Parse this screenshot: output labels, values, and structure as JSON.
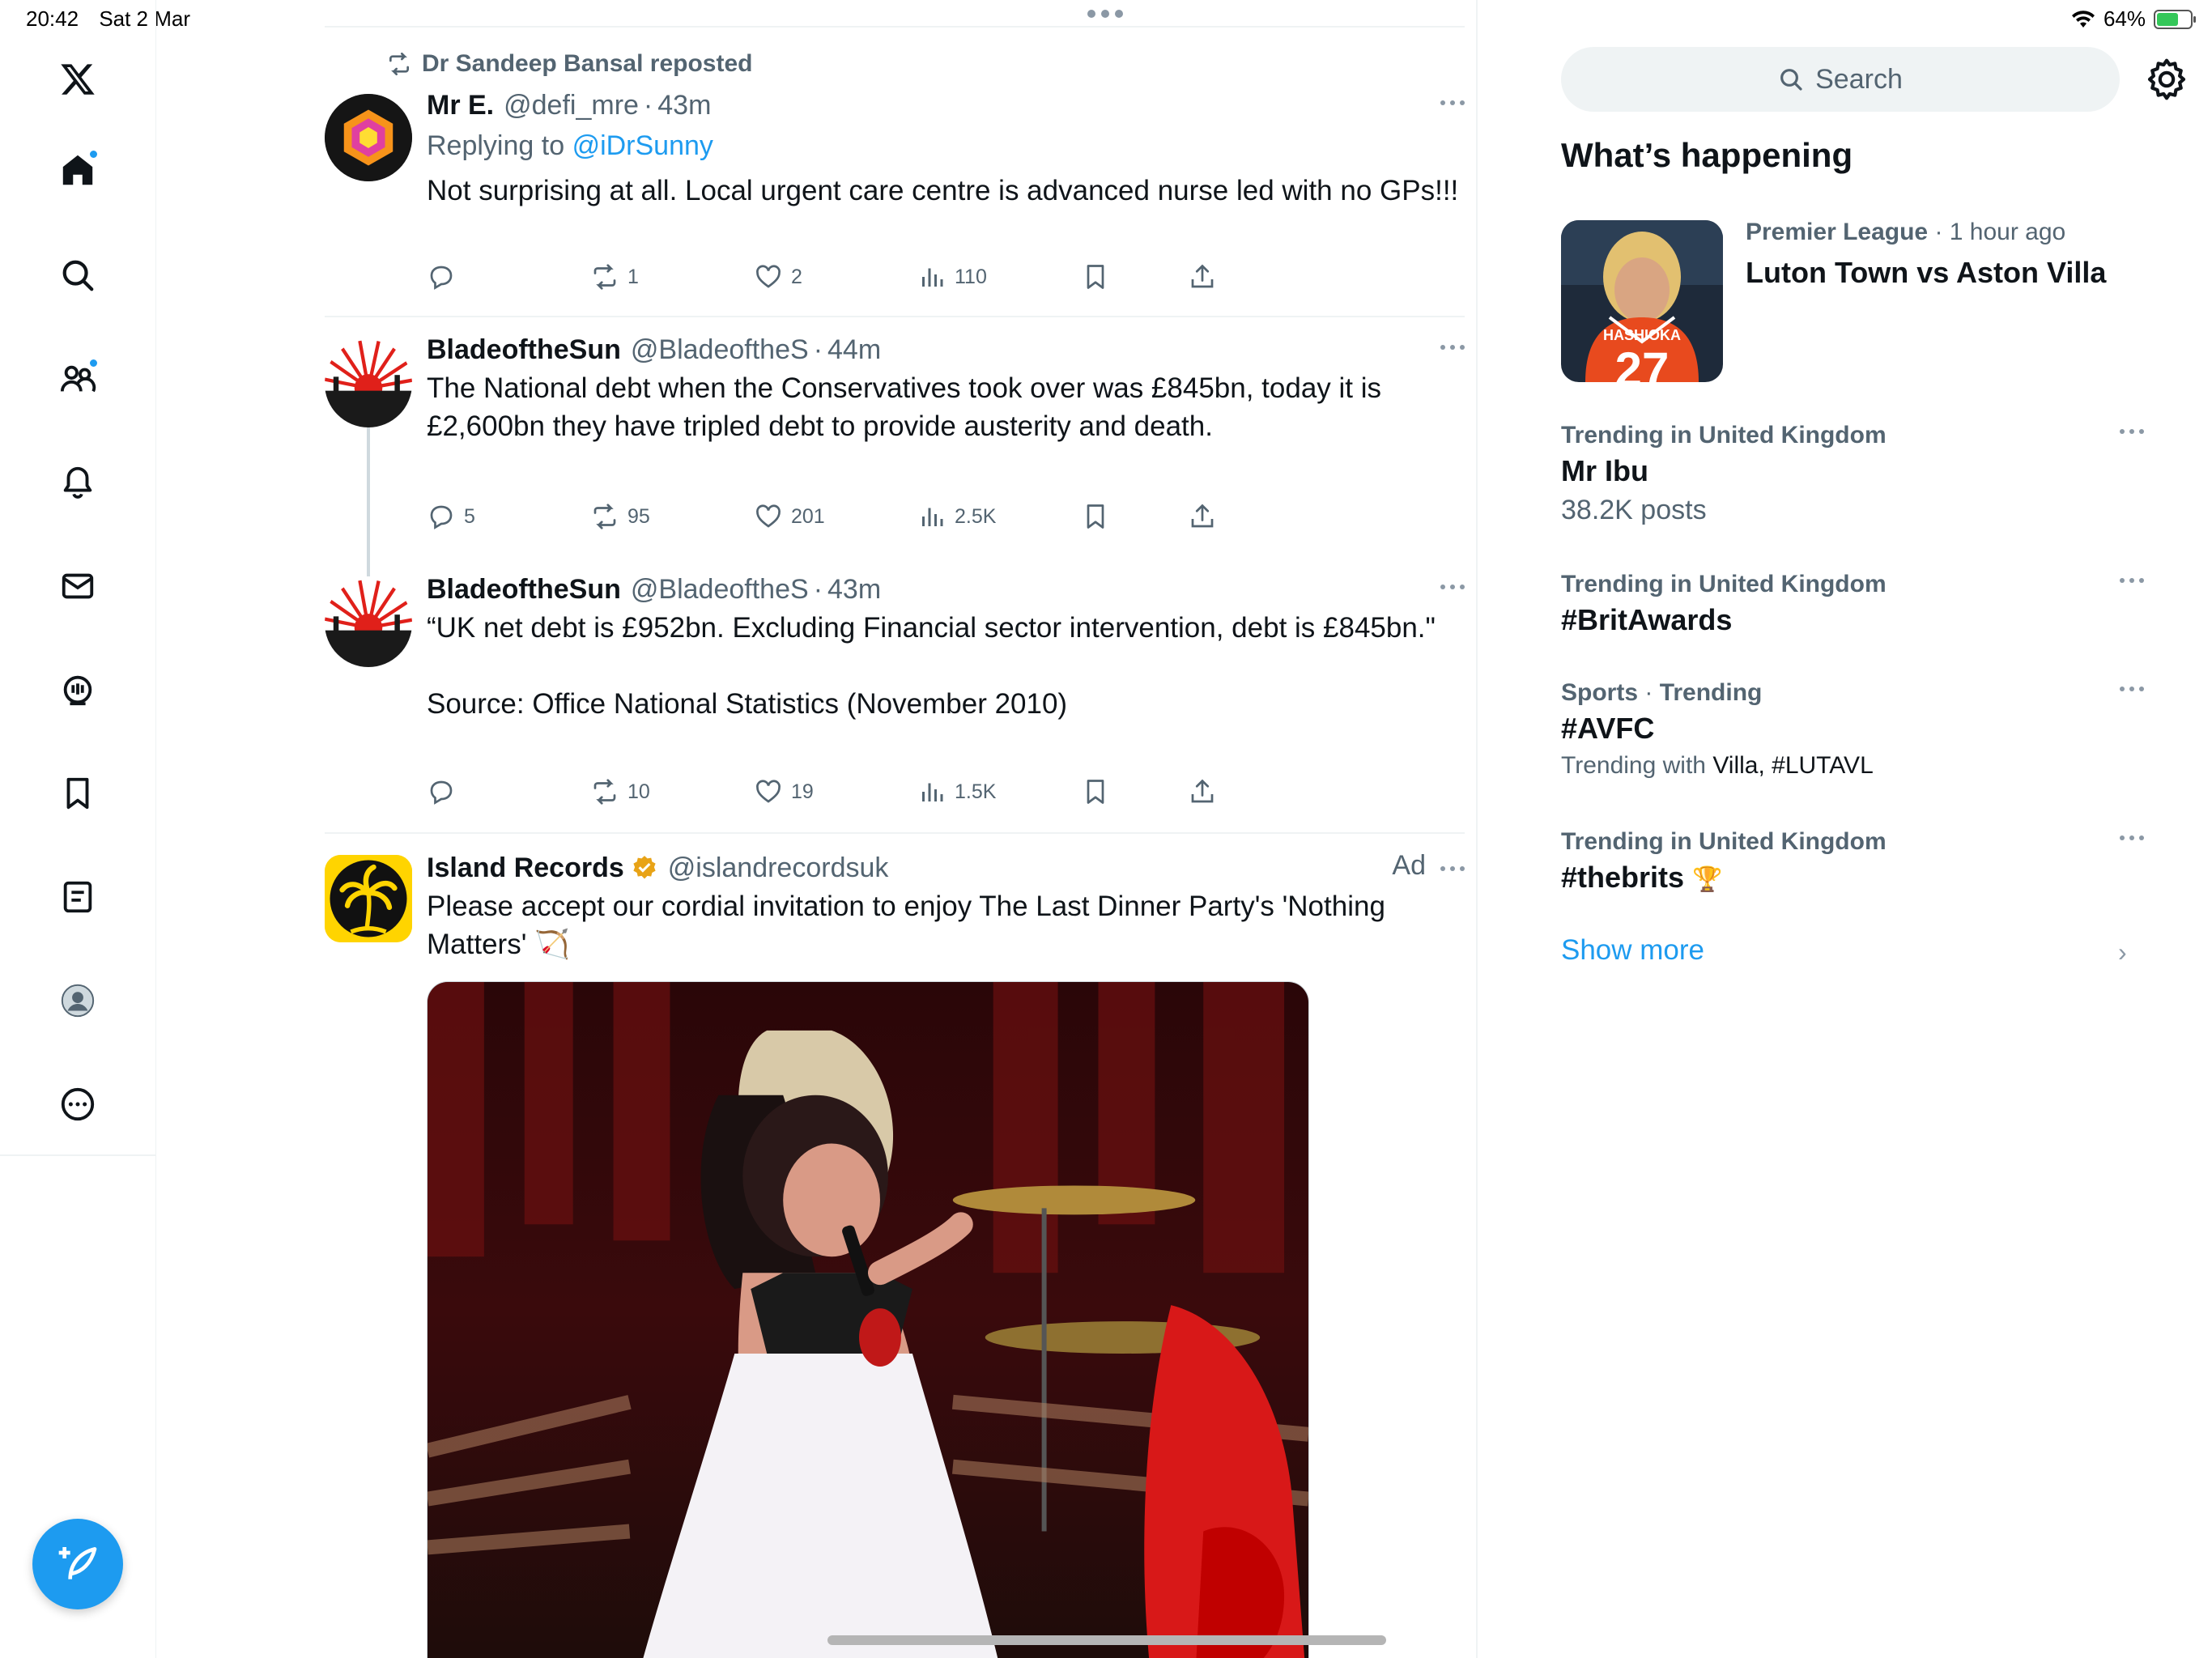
{
  "status_bar": {
    "time": "20:42",
    "date": "Sat 2 Mar",
    "battery": "64%",
    "battery_level": 0.64
  },
  "nav": {
    "items": [
      {
        "name": "x-logo-icon"
      },
      {
        "name": "home-icon",
        "dot": true
      },
      {
        "name": "search-icon"
      },
      {
        "name": "communities-icon",
        "dot": true
      },
      {
        "name": "notifications-icon"
      },
      {
        "name": "messages-icon"
      },
      {
        "name": "spaces-icon"
      },
      {
        "name": "bookmarks-icon"
      },
      {
        "name": "lists-icon"
      },
      {
        "name": "profile-icon"
      },
      {
        "name": "more-icon"
      }
    ],
    "compose_icon": "compose-icon",
    "accent_color": "#1d9bf0"
  },
  "feed": {
    "tweets": [
      {
        "repost_by": "Dr Sandeep Bansal reposted",
        "name": "Mr E.",
        "handle": "@defi_mre",
        "time": "43m",
        "reply_prefix": "Replying to",
        "reply_to": "@iDrSunny",
        "text": "Not surprising at all. Local urgent care centre is advanced nurse led with no GPs!!!",
        "replies": "",
        "reposts": "1",
        "likes": "2",
        "views": "110"
      },
      {
        "name": "BladeoftheSun",
        "handle": "@BladeoftheS",
        "time": "44m",
        "text": "The National debt when the Conservatives took over was £845bn, today it is £2,600bn they have tripled debt to provide austerity and death.",
        "replies": "5",
        "reposts": "95",
        "likes": "201",
        "views": "2.5K"
      },
      {
        "name": "BladeoftheSun",
        "handle": "@BladeoftheS",
        "time": "43m",
        "text": "“UK net debt is £952bn. Excluding Financial sector intervention, debt is £845bn.\"\n\nSource: Office National Statistics (November 2010)",
        "replies": "",
        "reposts": "10",
        "likes": "19",
        "views": "1.5K"
      },
      {
        "name": "Island Records",
        "handle": "@islandrecordsuk",
        "ad_label": "Ad",
        "text": "Please accept our cordial invitation to enjoy The Last Dinner Party's 'Nothing Matters' 🏹"
      }
    ]
  },
  "sidebar": {
    "search_placeholder": "Search",
    "section_title": "What’s happening",
    "featured": {
      "category": "Premier League",
      "time": "1 hour ago",
      "title": "Luton Town vs Aston Villa",
      "jersey_text": "HASHIOKA",
      "jersey_number": "27"
    },
    "trends": [
      {
        "meta": "Trending in United Kingdom",
        "title": "Mr Ibu",
        "sub": "38.2K posts"
      },
      {
        "meta": "Trending in United Kingdom",
        "title": "#BritAwards"
      },
      {
        "meta_a": "Sports",
        "meta_b": "Trending",
        "title": "#AVFC",
        "sub_prefix": "Trending with",
        "sub_items": "Villa, #LUTAVL"
      },
      {
        "meta": "Trending in United Kingdom",
        "title": "#thebrits",
        "emoji": "🏆"
      }
    ],
    "show_more": "Show more"
  }
}
